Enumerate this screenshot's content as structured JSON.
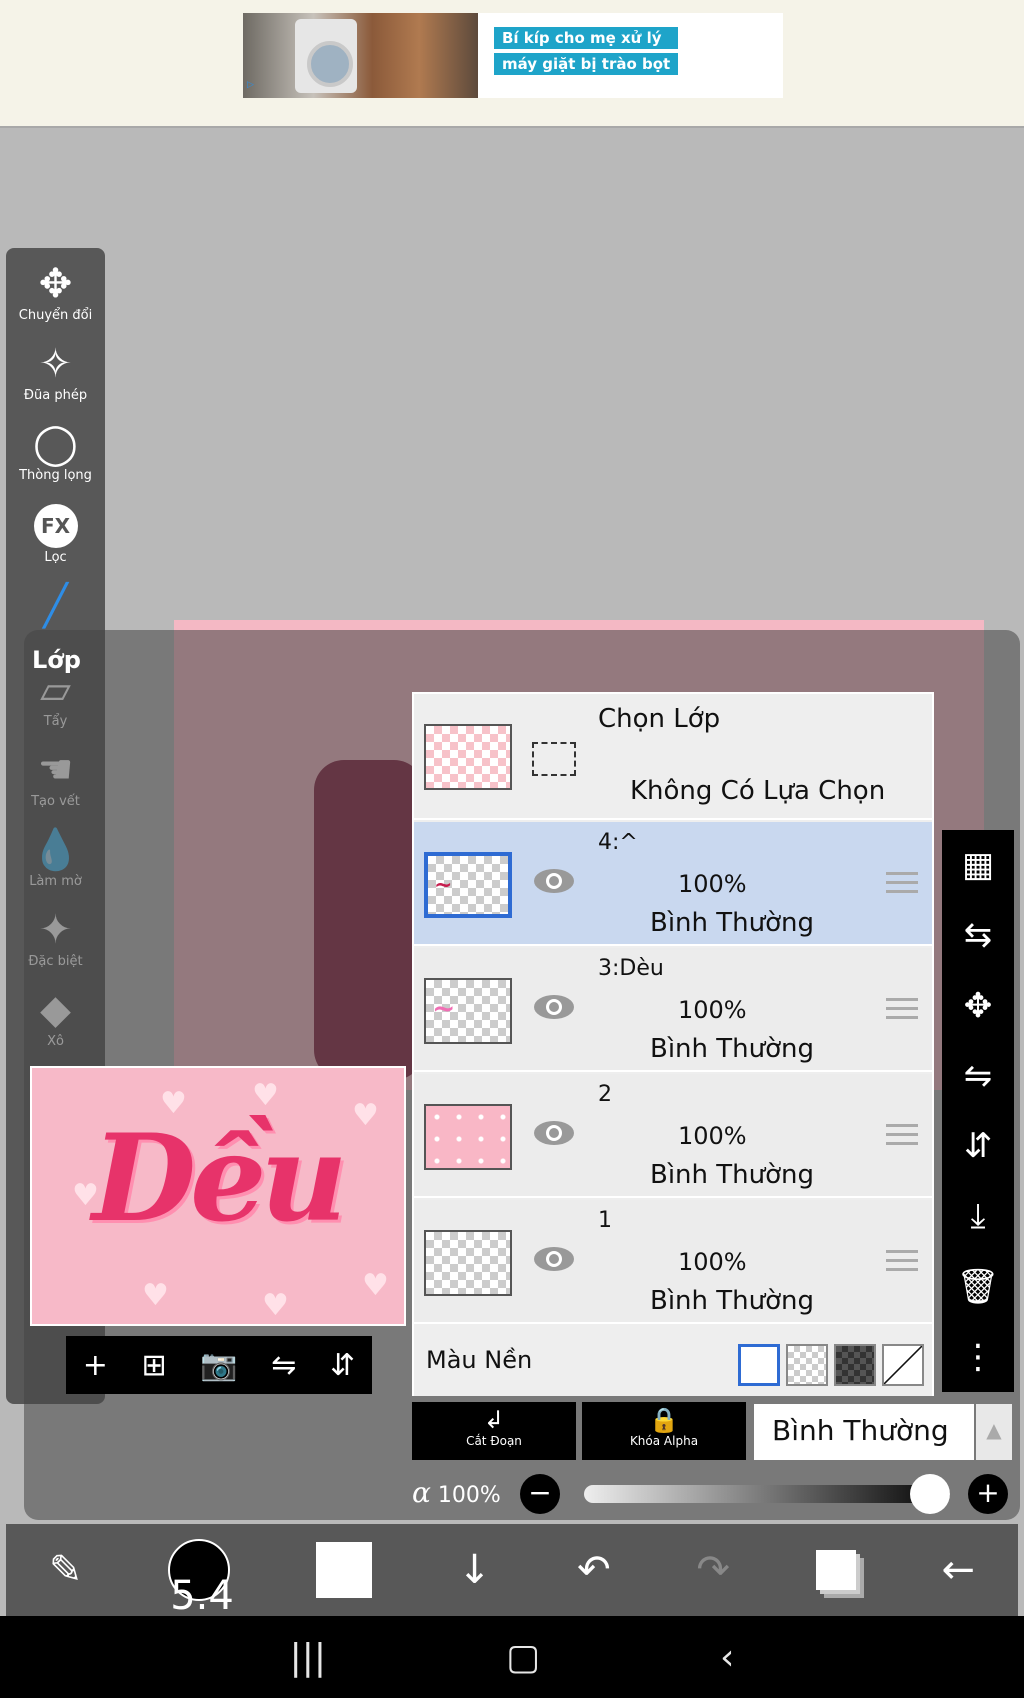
{
  "ad": {
    "line1": "Bí kíp cho mẹ xử lý",
    "line2": "máy giặt bị trào bọt"
  },
  "toolbar": {
    "tools": [
      {
        "label": "Chuyển đổi",
        "icon": "move-icon"
      },
      {
        "label": "Đũa phép",
        "icon": "magic-wand-icon"
      },
      {
        "label": "Thòng lọng",
        "icon": "lasso-icon"
      },
      {
        "label": "Lọc",
        "icon": "fx-icon"
      },
      {
        "label": "Tẩy",
        "icon": "eraser-icon"
      },
      {
        "label": "Tạo vết",
        "icon": "smudge-icon"
      },
      {
        "label": "Làm mờ",
        "icon": "blur-icon"
      },
      {
        "label": "Đặc biệt",
        "icon": "special-brush-icon"
      },
      {
        "label": "Xô",
        "icon": "bucket-icon"
      }
    ],
    "fx_text": "FX"
  },
  "layer_panel": {
    "heading": "Lớp",
    "select": {
      "title": "Chọn Lớp",
      "subtitle": "Không Có Lựa Chọn"
    },
    "layers": [
      {
        "name": "4:^",
        "opacity": "100%",
        "blend": "Bình Thường",
        "selected": true
      },
      {
        "name": "3:Dèu",
        "opacity": "100%",
        "blend": "Bình Thường",
        "selected": false
      },
      {
        "name": "2",
        "opacity": "100%",
        "blend": "Bình Thường",
        "selected": false
      },
      {
        "name": "1",
        "opacity": "100%",
        "blend": "Bình Thường",
        "selected": false
      }
    ],
    "background": {
      "label": "Màu Nền"
    }
  },
  "preview": {
    "text": "Dều"
  },
  "controls": {
    "clip_label": "Cắt Đoạn",
    "alpha_lock_label": "Khóa Alpha",
    "blend_mode": "Bình Thường",
    "alpha_symbol": "α",
    "alpha_value": "100%",
    "opacity": 1.0
  },
  "bottom_bar": {
    "brush_size": "5.4",
    "layer_count": "4"
  },
  "colors": {
    "selected_layer_bg": "#c9d8ef",
    "accent_blue": "#2e6bd3",
    "art_pink": "#f4b8c4",
    "art_red": "#e7336a"
  }
}
